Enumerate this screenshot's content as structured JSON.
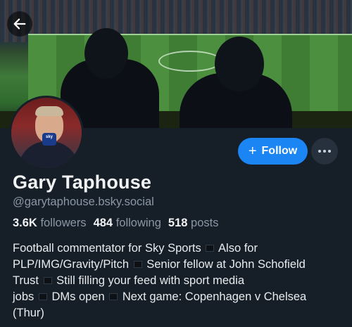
{
  "profile": {
    "display_name": "Gary Taphouse",
    "handle": "@garytaphouse.bsky.social",
    "stats": {
      "followers_count": "3.6K",
      "followers_label": "followers",
      "following_count": "484",
      "following_label": "following",
      "posts_count": "518",
      "posts_label": "posts"
    },
    "bio_lines": [
      "Football commentator for Sky Sports ",
      " Also for",
      "PLP/IMG/Gravity/Pitch ",
      " Senior fellow at John Schofield",
      "Trust ",
      " Still filling your feed with sport media",
      "jobs ",
      " DMs open ",
      " Next game: Copenhagen v Chelsea",
      "(Thur)"
    ],
    "avatar_badge": "sky"
  },
  "actions": {
    "follow_label": "Follow",
    "follow_icon": "plus-icon",
    "more_icon": "ellipsis-icon",
    "back_icon": "back-arrow-icon"
  },
  "colors": {
    "background": "#161e27",
    "accent": "#1b85f3",
    "muted_text": "#8a97a6"
  }
}
